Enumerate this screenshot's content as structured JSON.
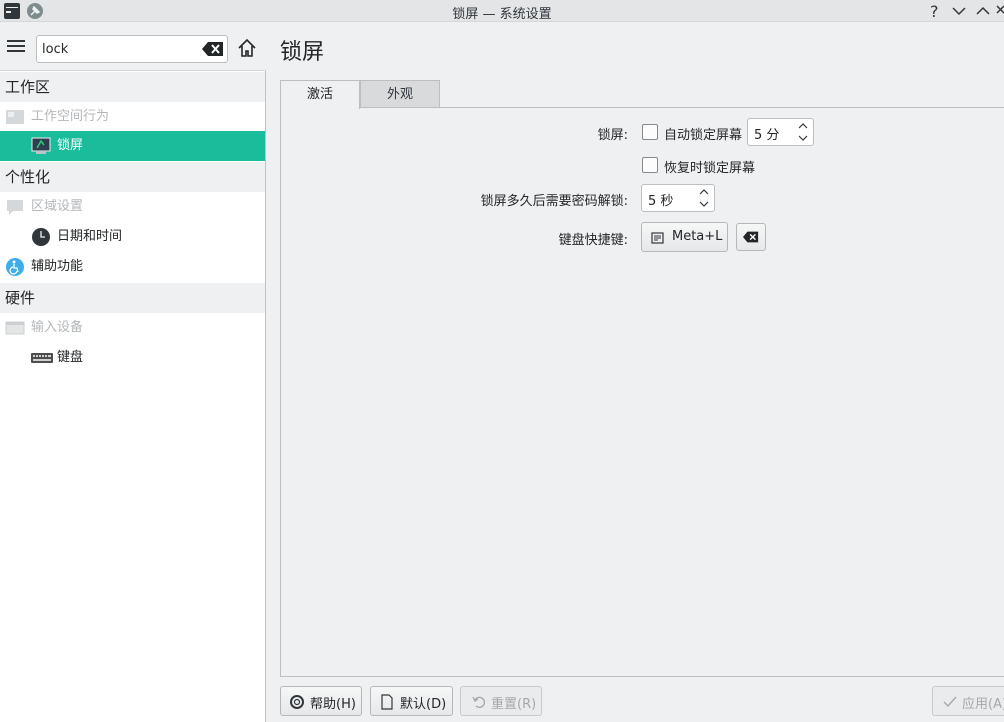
{
  "window": {
    "title": "锁屏 — 系统设置"
  },
  "sidebar": {
    "search": {
      "value": "lock",
      "placeholder": ""
    },
    "categories": [
      {
        "label": "工作区",
        "items": [
          {
            "label": "工作空间行为",
            "icon": "workspace-icon",
            "state": "disabled"
          },
          {
            "label": "锁屏",
            "icon": "lock-screen-icon",
            "state": "selected"
          }
        ]
      },
      {
        "label": "个性化",
        "items": [
          {
            "label": "区域设置",
            "icon": "region-icon",
            "state": "disabled"
          },
          {
            "label": "日期和时间",
            "icon": "clock-icon",
            "state": "normal"
          },
          {
            "label": "辅助功能",
            "icon": "accessibility-icon",
            "state": "normal"
          }
        ]
      },
      {
        "label": "硬件",
        "items": [
          {
            "label": "输入设备",
            "icon": "input-devices-icon",
            "state": "disabled"
          },
          {
            "label": "键盘",
            "icon": "keyboard-icon",
            "state": "normal"
          }
        ]
      }
    ]
  },
  "main": {
    "title": "锁屏",
    "tabs": [
      {
        "label": "激活",
        "active": true
      },
      {
        "label": "外观",
        "active": false
      }
    ],
    "form": {
      "lock_label": "锁屏:",
      "auto_lock_label": "自动锁定屏幕",
      "auto_lock_checked": false,
      "auto_lock_value": "5 分",
      "resume_lock_label": "恢复时锁定屏幕",
      "resume_lock_checked": false,
      "password_delay_label": "锁屏多久后需要密码解锁:",
      "password_delay_value": "5 秒",
      "shortcut_label": "键盘快捷键:",
      "shortcut_value": "Meta+L"
    }
  },
  "footer": {
    "help": "帮助(H)",
    "defaults": "默认(D)",
    "reset": "重置(R)",
    "apply": "应用(A)"
  },
  "colors": {
    "accent": "#1abc9c",
    "background": "#eff0f1"
  }
}
